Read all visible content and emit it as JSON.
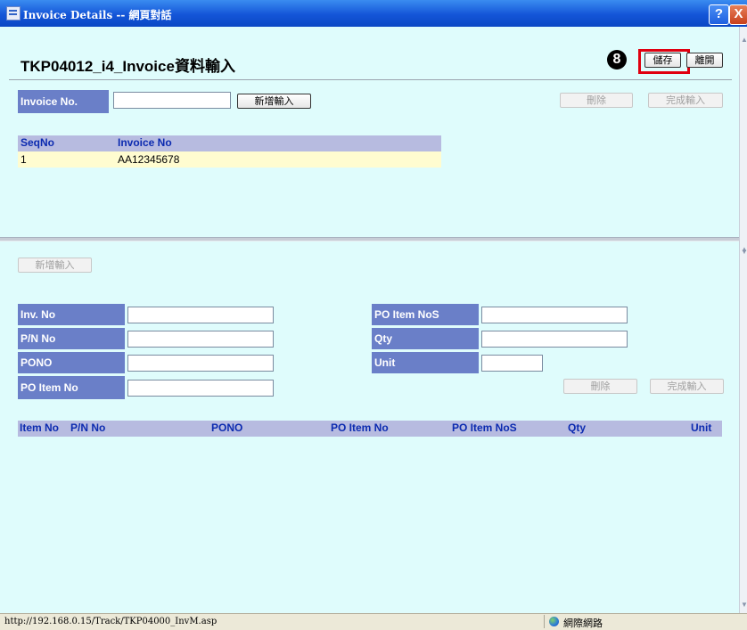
{
  "window": {
    "title": "Invoice Details -- 網頁對話",
    "help": "?",
    "close": "X"
  },
  "page": {
    "title": "TKP04012_i4_Invoice資料輸入",
    "step_badge": "8",
    "save": "儲存",
    "leave": "離開"
  },
  "invoice_section": {
    "label": "Invoice No.",
    "input_value": "",
    "add": "新增輸入",
    "delete": "刪除",
    "finish": "完成輸入",
    "table": {
      "headers": [
        "SeqNo",
        "Invoice No"
      ],
      "rows": [
        [
          "1",
          "AA12345678"
        ]
      ]
    }
  },
  "item_section": {
    "add": "新增輸入",
    "left_fields": [
      {
        "label": "Inv. No",
        "value": ""
      },
      {
        "label": "P/N No",
        "value": ""
      },
      {
        "label": "PONO",
        "value": ""
      },
      {
        "label": "PO Item No",
        "value": ""
      }
    ],
    "right_fields": [
      {
        "label": "PO Item NoS",
        "value": ""
      },
      {
        "label": "Qty",
        "value": ""
      },
      {
        "label": "Unit",
        "value": ""
      }
    ],
    "delete": "刪除",
    "finish": "完成輸入",
    "table_headers": [
      "Item No",
      "P/N No",
      "PONO",
      "PO Item No",
      "PO Item NoS",
      "Qty",
      "Unit"
    ]
  },
  "statusbar": {
    "url": "http://192.168.0.15/Track/TKP04000_InvM.asp",
    "zone": "網際網路"
  }
}
